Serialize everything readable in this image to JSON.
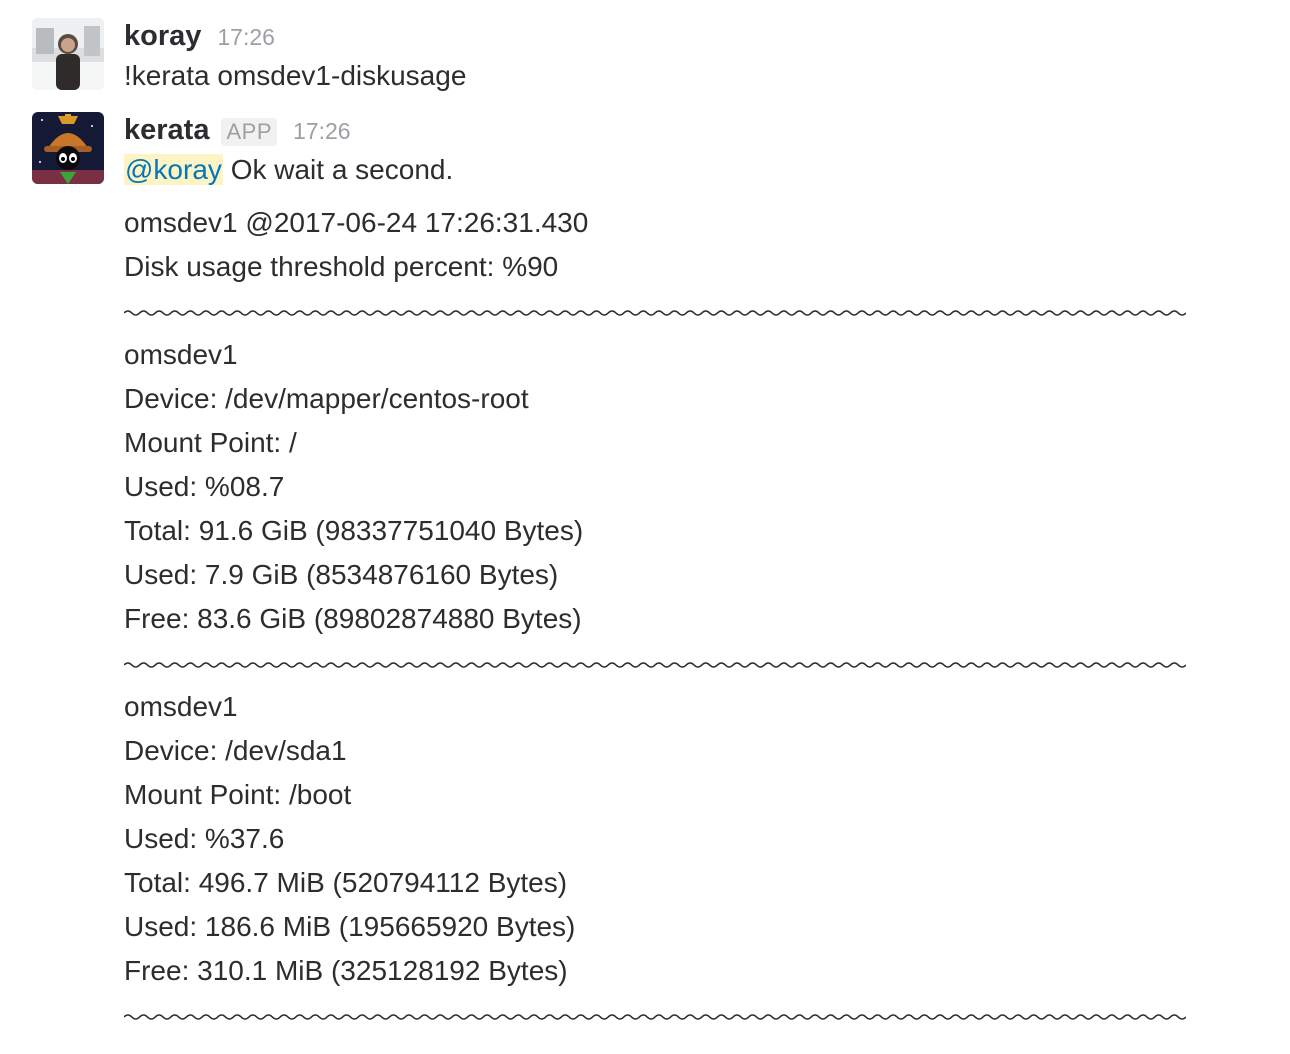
{
  "messages": [
    {
      "sender": "koray",
      "time": "17:26",
      "text": "!kerata omsdev1-diskusage",
      "avatar_icon": "user-photo-avatar"
    },
    {
      "sender": "kerata",
      "badge": "APP",
      "time": "17:26",
      "mention": "@koray",
      "text": "Ok wait a second.",
      "avatar_icon": "marvin-martian-avatar",
      "lines": {
        "header1": "omsdev1 @2017-06-24 17:26:31.430",
        "header2": "Disk usage threshold percent: %90",
        "separator": "~~~~~~~~~~~~~~~~~~~~~~~~~~~~~~~~~~~~~~~~~~~~~~~~~~~~~~~~~~~~~~~~~~~~",
        "disks": [
          {
            "host": "omsdev1",
            "device": "Device: /dev/mapper/centos-root",
            "mount": "Mount Point: /",
            "used_pct": "Used: %08.7",
            "total": "Total: 91.6 GiB (98337751040 Bytes)",
            "used": "Used: 7.9 GiB (8534876160 Bytes)",
            "free": "Free: 83.6 GiB (89802874880 Bytes)"
          },
          {
            "host": "omsdev1",
            "device": "Device: /dev/sda1",
            "mount": "Mount Point: /boot",
            "used_pct": "Used: %37.6",
            "total": "Total: 496.7 MiB (520794112 Bytes)",
            "used": "Used: 186.6 MiB (195665920 Bytes)",
            "free": "Free: 310.1 MiB (325128192 Bytes)"
          }
        ]
      }
    }
  ],
  "colors": {
    "text": "#2c2d30",
    "muted": "#9e9ea6",
    "mention": "#0576b9",
    "mention_bg": "#fcf4c4"
  }
}
